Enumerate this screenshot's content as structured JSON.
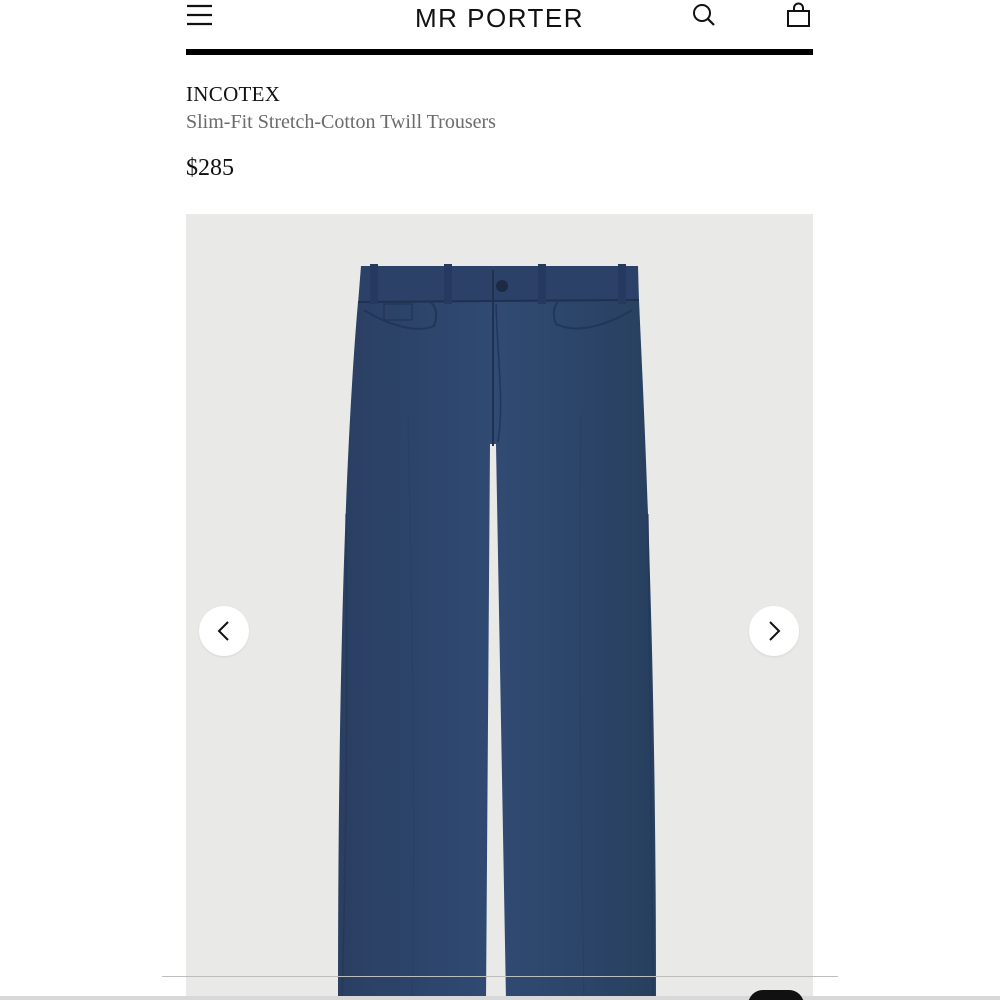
{
  "header": {
    "logo": "MR PORTER",
    "menu_icon": "hamburger-menu-icon",
    "search_icon": "search-icon",
    "bag_icon": "shopping-bag-icon"
  },
  "product": {
    "designer": "INCOTEX",
    "name": "Slim-Fit Stretch-Cotton Twill Trousers",
    "price": "$285",
    "color": "#2d4468"
  },
  "gallery": {
    "background": "#e9e9e8",
    "prev_icon": "chevron-left-icon",
    "next_icon": "chevron-right-icon"
  }
}
